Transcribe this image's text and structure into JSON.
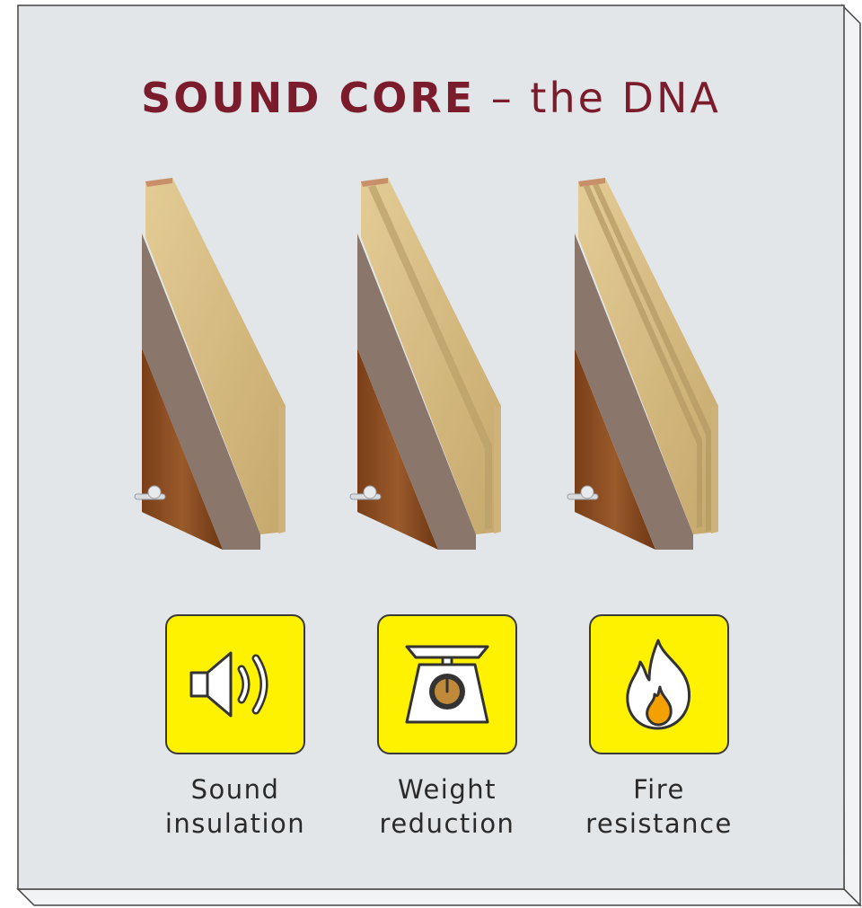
{
  "title": {
    "bold": "SOUND CORE",
    "dash": "–",
    "light": "the DNA"
  },
  "colors": {
    "title": "#7a1c2c",
    "panel": "#e3e6e9",
    "panel_edge": "#f1f2f3",
    "icon_box": "#fff200",
    "wood": "#8a4c22",
    "core": "#d8c08a",
    "skin": "#8a766c"
  },
  "doors": [
    {
      "name": "door-single-core",
      "core_channels": 0
    },
    {
      "name": "door-double-core",
      "core_channels": 1
    },
    {
      "name": "door-triple-core",
      "core_channels": 2
    }
  ],
  "features": [
    {
      "icon": "speaker-icon",
      "line1": "Sound",
      "line2": "insulation"
    },
    {
      "icon": "scale-icon",
      "line1": "Weight",
      "line2": "reduction"
    },
    {
      "icon": "flame-icon",
      "line1": "Fire",
      "line2": "resistance"
    }
  ]
}
